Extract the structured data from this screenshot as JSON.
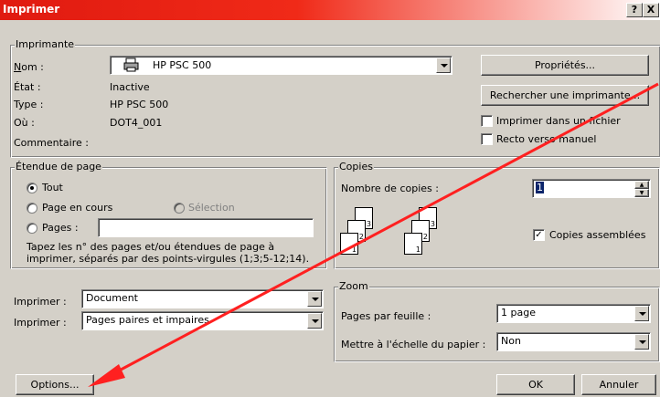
{
  "window": {
    "title": "Imprimer",
    "help_btn": "?",
    "close_btn": "X"
  },
  "printer": {
    "group_label": "Imprimante",
    "name_label": "Nom :",
    "name_value": "HP PSC 500",
    "status_label": "État :",
    "status_value": "Inactive",
    "type_label": "Type :",
    "type_value": "HP PSC 500",
    "where_label": "Où :",
    "where_value": "DOT4_001",
    "comment_label": "Commentaire :",
    "properties_button": "Propriétés...",
    "find_printer_button": "Rechercher une imprimante...",
    "print_to_file_label": "Imprimer dans un fichier",
    "manual_duplex_label": "Recto verso manuel"
  },
  "page_range": {
    "group_label": "Étendue de page",
    "all_label": "Tout",
    "current_label": "Page en cours",
    "selection_label": "Sélection",
    "pages_label": "Pages :",
    "pages_value": "",
    "hint": "Tapez les n° des pages et/ou étendues de page à imprimer, séparés par des points-virgules (1;3;5-12;14)."
  },
  "copies": {
    "group_label": "Copies",
    "count_label": "Nombre de copies :",
    "count_value": "1",
    "collate_label": "Copies assemblées",
    "page_numbers": [
      "3",
      "2",
      "1",
      "3",
      "2",
      "1"
    ]
  },
  "print_what": {
    "label": "Imprimer :",
    "value": "Document"
  },
  "print_pages": {
    "label": "Imprimer :",
    "value": "Pages paires et impaires"
  },
  "zoom": {
    "group_label": "Zoom",
    "pages_per_sheet_label": "Pages par feuille :",
    "pages_per_sheet_value": "1 page",
    "scale_label": "Mettre à l'échelle du papier :",
    "scale_value": "Non"
  },
  "footer": {
    "options_button": "Options...",
    "ok_button": "OK",
    "cancel_button": "Annuler"
  },
  "colors": {
    "annotation_arrow": "#ff2020",
    "titlebar": "#e01a10"
  }
}
